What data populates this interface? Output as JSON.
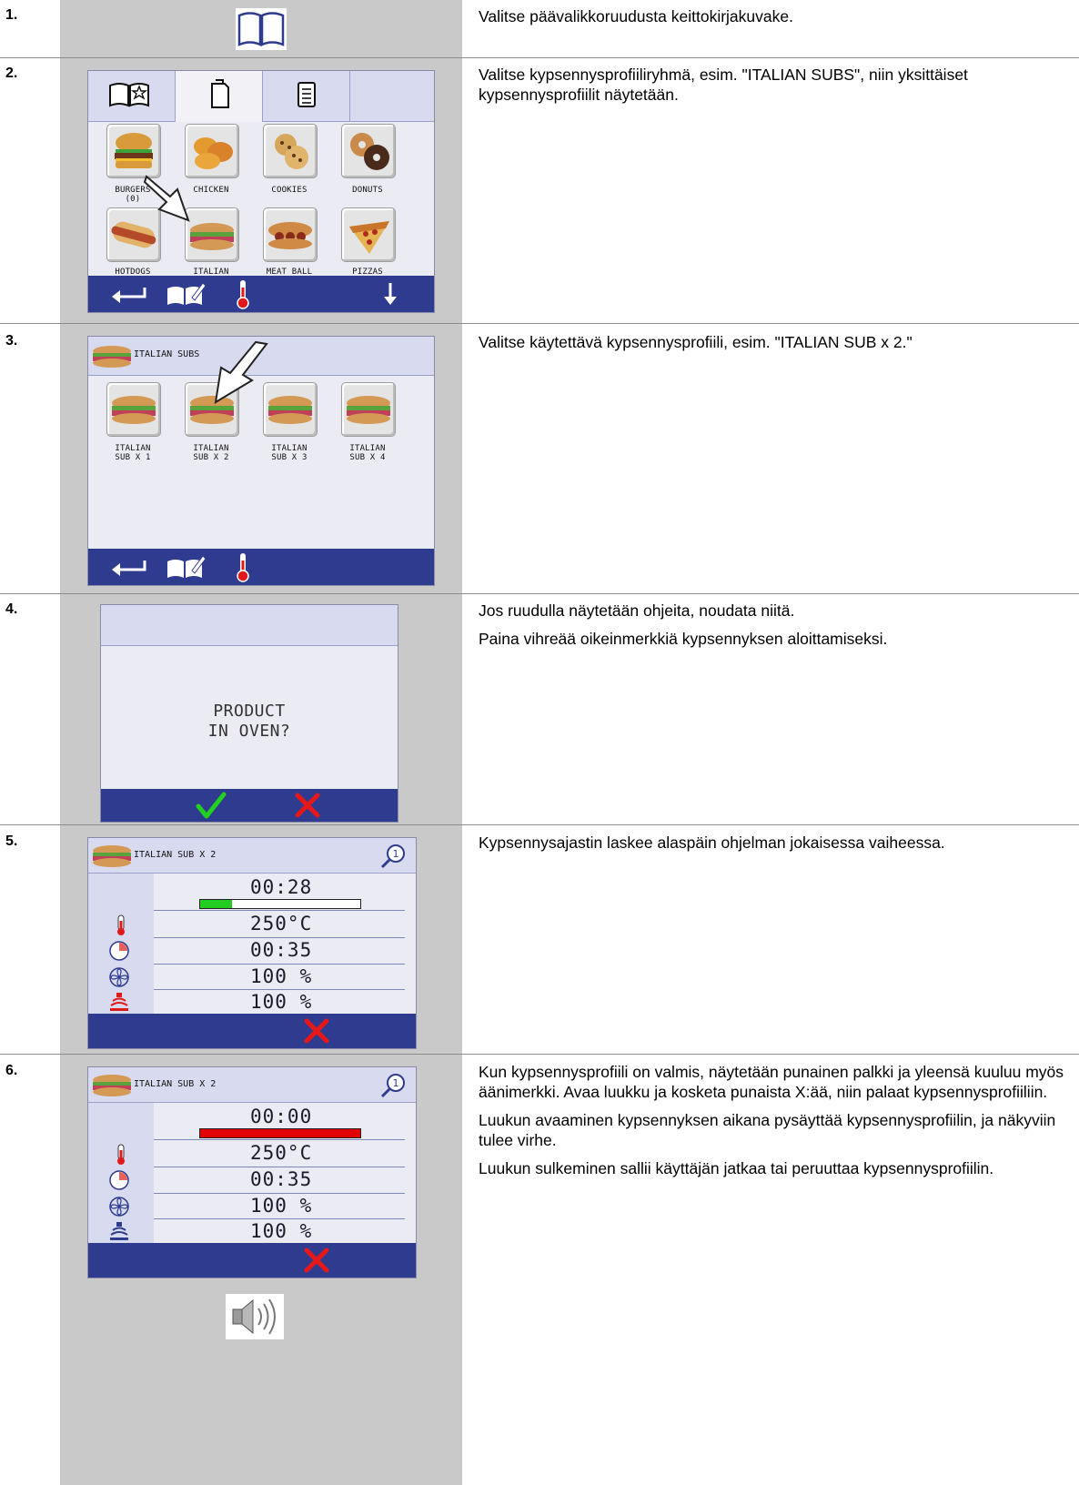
{
  "steps": [
    {
      "number": "1.",
      "desc": [
        "Valitse päävalikkoruudusta keittokirjakuvake."
      ]
    },
    {
      "number": "2.",
      "desc": [
        "Valitse kypsennysprofiiliryhmä, esim. \"ITALIAN SUBS\", niin yksittäiset kypsennysprofiilit näytetään."
      ]
    },
    {
      "number": "3.",
      "desc": [
        "Valitse käytettävä kypsennysprofiili, esim. \"ITALIAN SUB x 2.\""
      ]
    },
    {
      "number": "4.",
      "desc": [
        "Jos ruudulla näytetään ohjeita, noudata niitä.",
        "Paina vihreää oikeinmerkkiä kypsennyksen aloittamiseksi."
      ]
    },
    {
      "number": "5.",
      "desc": [
        "Kypsennysajastin laskee alaspäin ohjelman jokaisessa vaiheessa."
      ]
    },
    {
      "number": "6.",
      "desc": [
        "Kun kypsennysprofiili on valmis, näytetään punainen palkki ja yleensä kuuluu myös äänimerkki. Avaa luukku ja kosketa punaista X:ää, niin palaat kypsennysprofiiliin.",
        "Luukun avaaminen kypsennyksen aikana pysäyttää kypsennysprofiilin, ja näkyviin tulee virhe.",
        "Luukun sulkeminen sallii käyttäjän jatkaa tai peruuttaa kypsennysprofiilin."
      ]
    }
  ],
  "screen2": {
    "tiles": [
      {
        "label": "BURGERS\n(0)"
      },
      {
        "label": "CHICKEN"
      },
      {
        "label": "COOKIES"
      },
      {
        "label": "DONUTS"
      },
      {
        "label": "HOTDOGS"
      },
      {
        "label": "ITALIAN\nSUBS"
      },
      {
        "label": "MEAT BALL\nSUBS"
      },
      {
        "label": "PIZZAS"
      }
    ]
  },
  "screen3": {
    "title": "ITALIAN SUBS",
    "tiles": [
      {
        "label": "ITALIAN\nSUB X 1"
      },
      {
        "label": "ITALIAN\nSUB X 2"
      },
      {
        "label": "ITALIAN\nSUB X 3"
      },
      {
        "label": "ITALIAN\nSUB X 4"
      }
    ]
  },
  "screen4": {
    "line1": "PRODUCT",
    "line2": "IN OVEN?"
  },
  "screen5": {
    "title": "ITALIAN SUB X 2",
    "timer": "00:28",
    "progress": 0.2,
    "progress_color": "#22cc22",
    "temp": "250°C",
    "time": "00:35",
    "fan": "100 %",
    "power": "100 %"
  },
  "screen6": {
    "title": "ITALIAN SUB X 2",
    "timer": "00:00",
    "progress": 1.0,
    "progress_color": "#e00000",
    "temp": "250°C",
    "time": "00:35",
    "fan": "100 %",
    "power": "100 %"
  },
  "colors": {
    "bar": "#2e3b8f",
    "panel": "#d8dbef",
    "gray": "#c9c9c9"
  }
}
